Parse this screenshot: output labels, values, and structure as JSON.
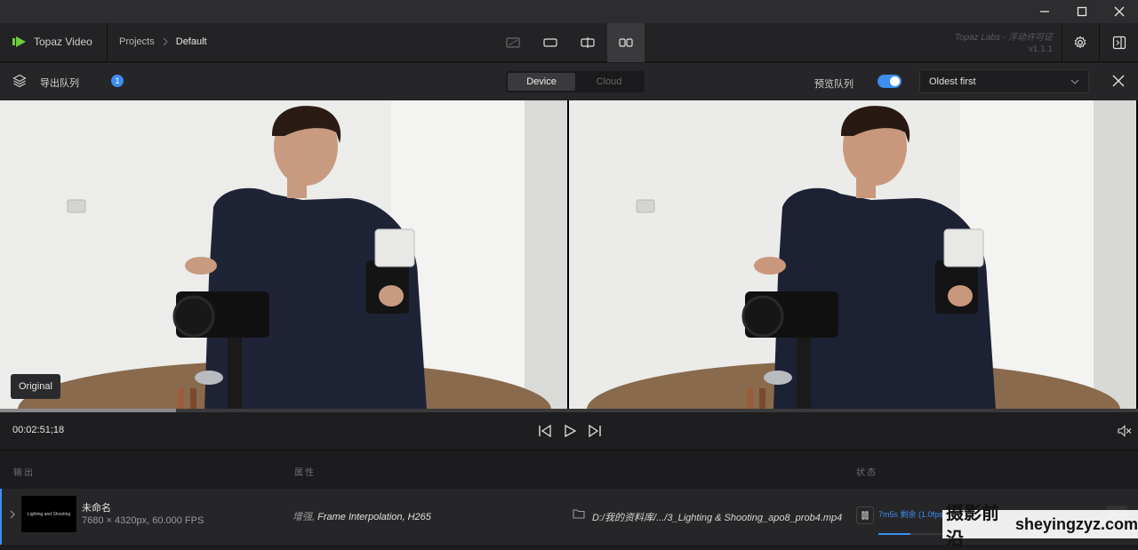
{
  "titlebar": {
    "minimize_icon": "minimize-icon",
    "maximize_icon": "maximize-icon",
    "close_icon": "close-icon"
  },
  "appbar": {
    "app_name": "Topaz Video",
    "breadcrumb": {
      "parent": "Projects",
      "current": "Default"
    },
    "brand": "Topaz Labs - 浮动许可证",
    "version": "v1.1.1"
  },
  "queue": {
    "title": "导出队列",
    "badge_count": "1",
    "device_label": "Device",
    "cloud_label": "Cloud",
    "preview_label": "预览队列",
    "preview_on": true,
    "sort_value": "Oldest first"
  },
  "viewer": {
    "original_tag": "Original",
    "timecode": "00:02:51;18",
    "scrub_progress": 0.155
  },
  "table": {
    "headers": {
      "output": "输出",
      "properties": "属性",
      "status": "状态"
    }
  },
  "job": {
    "thumb_text": "Lighting and Shooting",
    "name": "未命名",
    "meta": "7680 × 4320px, 60.000 FPS",
    "props_prefix": "增强,",
    "props_rest": " Frame Interpolation, H265",
    "path": "D:/我的资料库/.../3_Lighting & Shooting_apo8_prob4.mp4",
    "status": "7m5s 剩余 (1.0fps)",
    "progress": 0.3
  },
  "watermark": {
    "cn": "摄影前沿",
    "latin": "sheyingzyz.com"
  },
  "colors": {
    "accent": "#3d8ef0",
    "logo_green": "#6fcf3b"
  }
}
